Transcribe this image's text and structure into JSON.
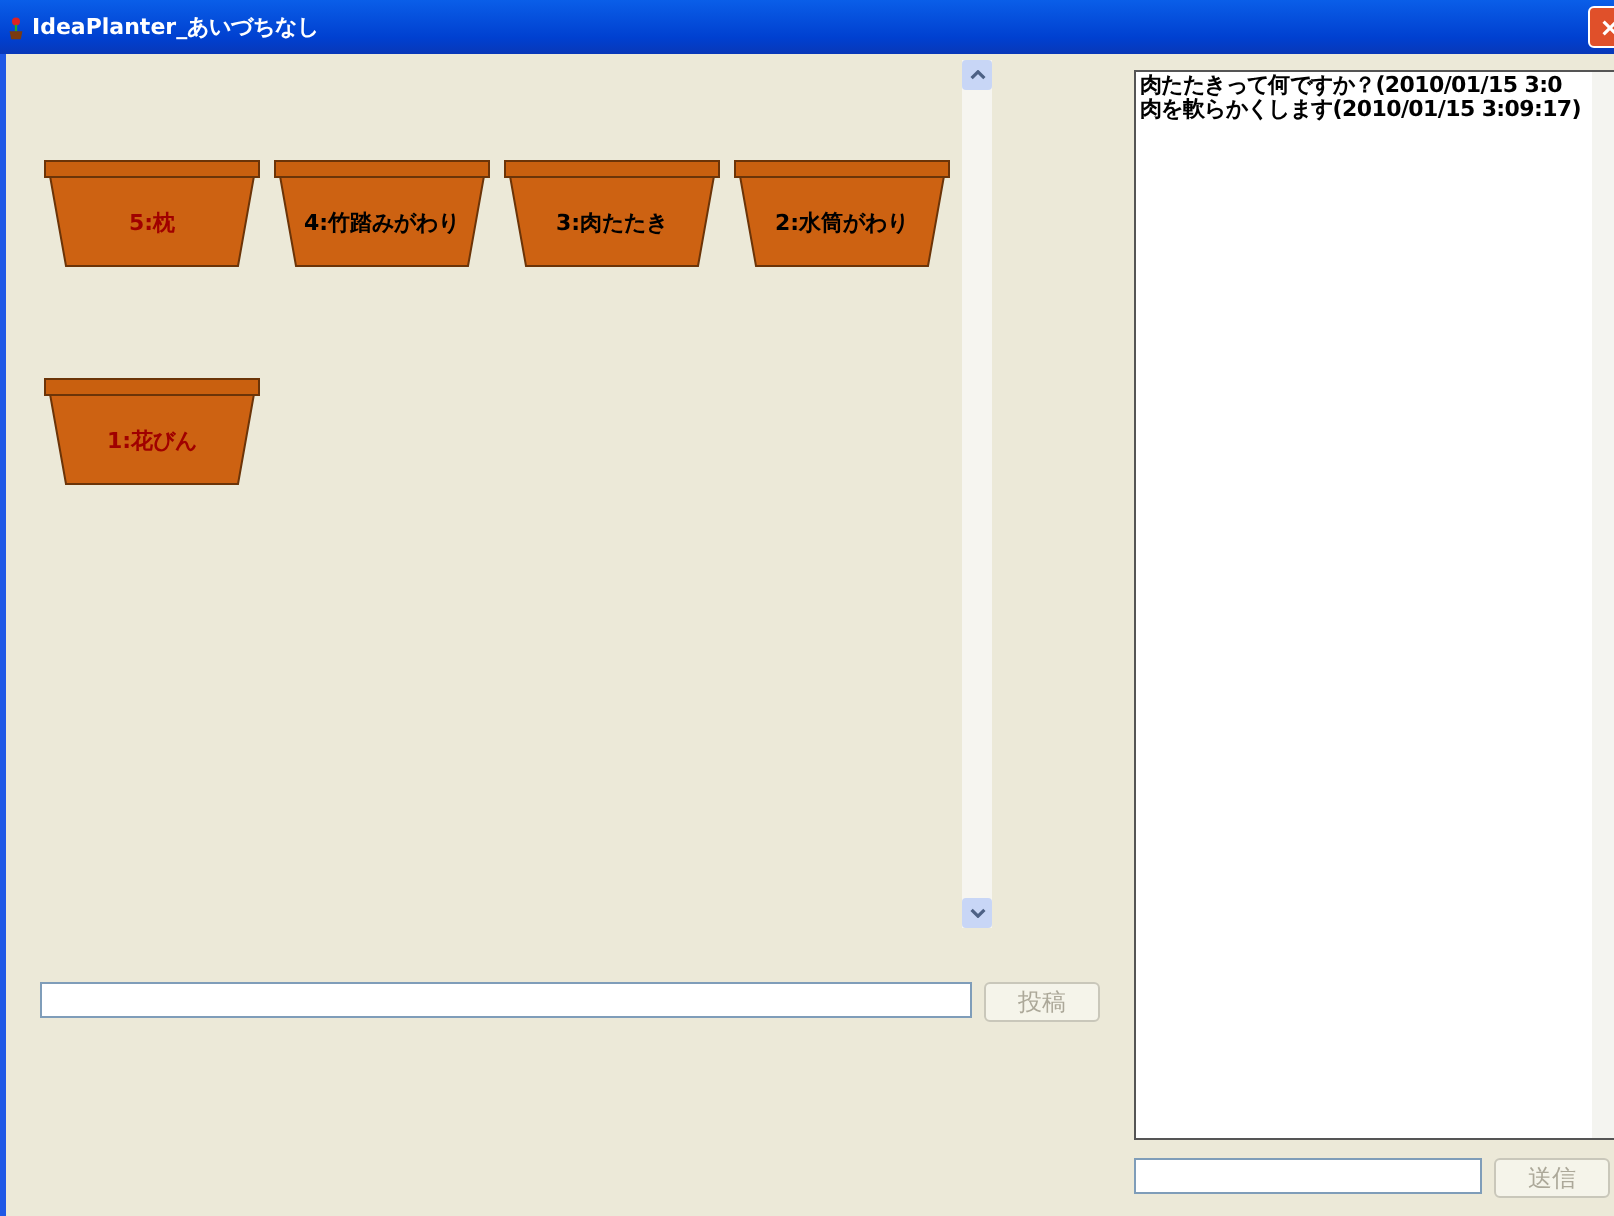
{
  "window": {
    "title": "IdeaPlanter_あいづちなし"
  },
  "pots": [
    {
      "label": "5:枕",
      "color": "#a00000"
    },
    {
      "label": "4:竹踏みがわり",
      "color": "#000000"
    },
    {
      "label": "3:肉たたき",
      "color": "#000000"
    },
    {
      "label": "2:水筒がわり",
      "color": "#000000"
    },
    {
      "label": "1:花びん",
      "color": "#a00000"
    }
  ],
  "post": {
    "button": "投稿",
    "disabled": true
  },
  "chat": {
    "messages": [
      "肉たたきって何ですか？(2010/01/15 3:0",
      "肉を軟らかくします(2010/01/15 3:09:17)"
    ],
    "button": "送信",
    "disabled": true
  }
}
